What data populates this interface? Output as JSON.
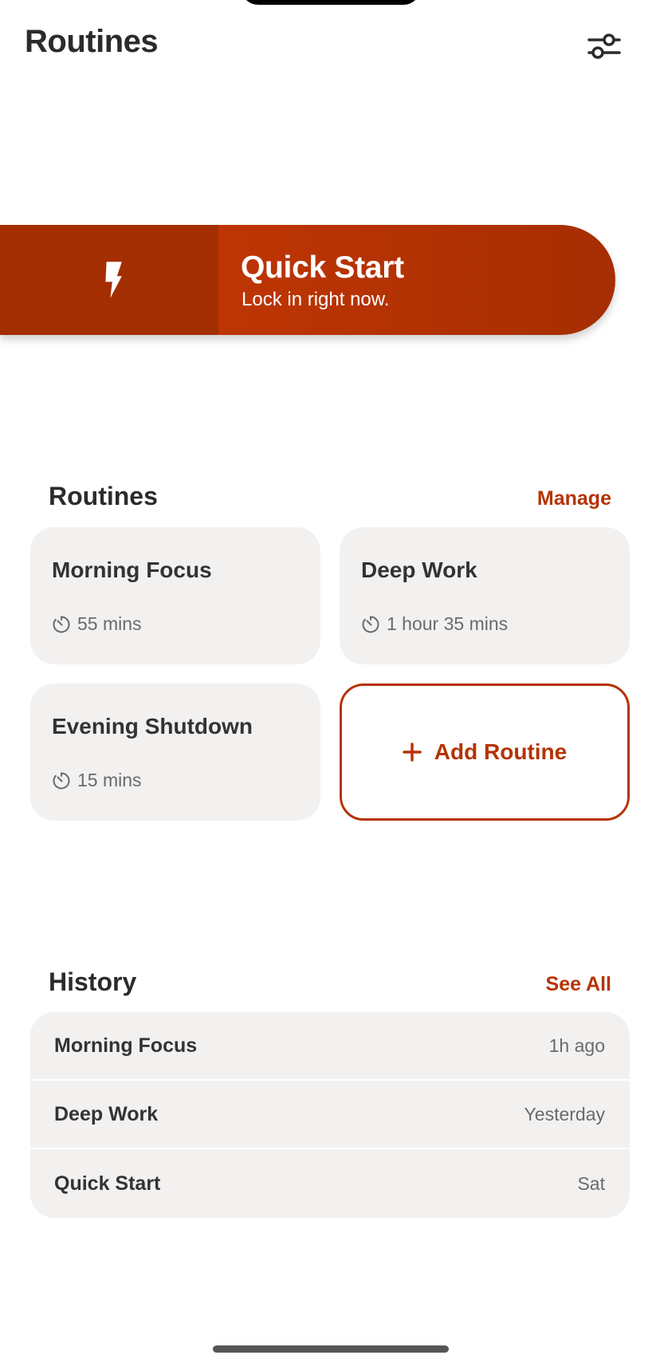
{
  "header": {
    "title": "Routines",
    "settings_icon": "sliders-icon"
  },
  "quick_start": {
    "title": "Quick Start",
    "subtitle": "Lock in right now.",
    "icon": "lightning-bolt-icon"
  },
  "routines_section": {
    "title": "Routines",
    "manage_label": "Manage",
    "items": [
      {
        "name": "Morning Focus",
        "duration": "55 mins"
      },
      {
        "name": "Deep Work",
        "duration": "1 hour 35 mins"
      },
      {
        "name": "Evening Shutdown",
        "duration": "15 mins"
      }
    ],
    "add_label": "Add Routine"
  },
  "history_section": {
    "title": "History",
    "see_all_label": "See All",
    "items": [
      {
        "name": "Morning Focus",
        "time": "1h ago"
      },
      {
        "name": "Deep Work",
        "time": "Yesterday"
      },
      {
        "name": "Quick Start",
        "time": "Sat"
      }
    ]
  },
  "colors": {
    "accent": "#b53303",
    "accent_dark": "#a32e02",
    "card_bg": "#f3f1f0",
    "text_primary": "#2b2b2b",
    "text_secondary": "#6a6a6a"
  }
}
